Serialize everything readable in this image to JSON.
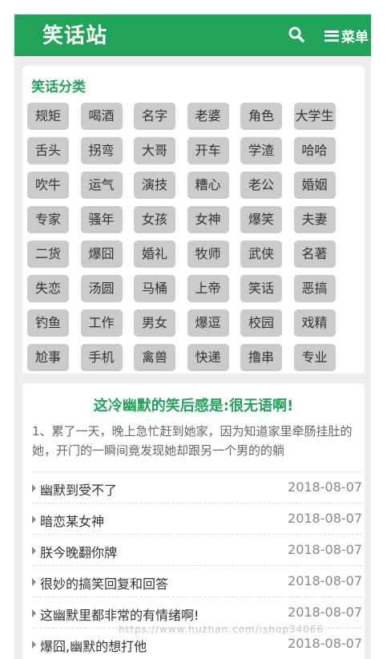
{
  "header": {
    "logo": "笑话站",
    "menu_label": "菜单"
  },
  "categories": {
    "title": "笑话分类",
    "tags": [
      "规矩",
      "喝酒",
      "名字",
      "老婆",
      "角色",
      "大学生",
      "舌头",
      "拐弯",
      "大哥",
      "开车",
      "学渣",
      "哈哈",
      "吹牛",
      "运气",
      "演技",
      "糟心",
      "老公",
      "婚姻",
      "专家",
      "骚年",
      "女孩",
      "女神",
      "爆笑",
      "夫妻",
      "二货",
      "爆囧",
      "婚礼",
      "牧师",
      "武侠",
      "名著",
      "失恋",
      "汤圆",
      "马桶",
      "上帝",
      "笑话",
      "恶搞",
      "钓鱼",
      "工作",
      "男女",
      "爆逗",
      "校园",
      "戏精",
      "尬事",
      "手机",
      "禽兽",
      "快递",
      "撸串",
      "专业"
    ]
  },
  "featured": {
    "title": "这冷幽默的笑后感是:很无语啊!",
    "text": "1、累了一天，晚上急忙赶到她家，因为知道家里牵肠挂肚的她，开门的一瞬间竟发现她却跟另一个男的的躺"
  },
  "list": [
    {
      "title": "幽默到受不了",
      "date": "2018-08-07"
    },
    {
      "title": "暗恋某女神",
      "date": "2018-08-07"
    },
    {
      "title": "朕今晚翻你牌",
      "date": "2018-08-07"
    },
    {
      "title": "很妙的搞笑回复和回答",
      "date": "2018-08-07"
    },
    {
      "title": "这幽默里都非常的有情绪啊!",
      "date": "2018-08-07"
    },
    {
      "title": "爆囧,幽默的想打他",
      "date": "2018-08-07"
    }
  ],
  "watermark": "https://www.huzhan.com/ishop34066",
  "colors": {
    "brand": "#22a35a",
    "tag_bg": "#cbcbcb",
    "page_bg": "#eeeeee"
  }
}
